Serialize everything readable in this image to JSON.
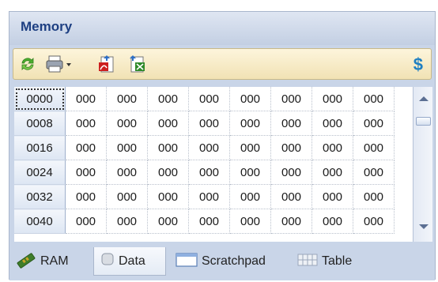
{
  "panel": {
    "title": "Memory"
  },
  "toolbar": {
    "refresh_icon": "refresh-icon",
    "print_icon": "printer-icon",
    "pdf_icon": "pdf-export-icon",
    "excel_icon": "excel-export-icon",
    "currency_symbol": "$"
  },
  "grid": {
    "rows": [
      {
        "address": "0000",
        "cells": [
          "000",
          "000",
          "000",
          "000",
          "000",
          "000",
          "000",
          "000"
        ]
      },
      {
        "address": "0008",
        "cells": [
          "000",
          "000",
          "000",
          "000",
          "000",
          "000",
          "000",
          "000"
        ]
      },
      {
        "address": "0016",
        "cells": [
          "000",
          "000",
          "000",
          "000",
          "000",
          "000",
          "000",
          "000"
        ]
      },
      {
        "address": "0024",
        "cells": [
          "000",
          "000",
          "000",
          "000",
          "000",
          "000",
          "000",
          "000"
        ]
      },
      {
        "address": "0032",
        "cells": [
          "000",
          "000",
          "000",
          "000",
          "000",
          "000",
          "000",
          "000"
        ]
      },
      {
        "address": "0040",
        "cells": [
          "000",
          "000",
          "000",
          "000",
          "000",
          "000",
          "000",
          "000"
        ]
      }
    ]
  },
  "tabs": [
    {
      "label": "RAM",
      "icon": "ram-chip-icon"
    },
    {
      "label": "Data",
      "icon": "database-icon"
    },
    {
      "label": "Scratchpad",
      "icon": "window-icon"
    },
    {
      "label": "Table",
      "icon": "table-grid-icon"
    }
  ],
  "colors": {
    "title": "#1d3f82",
    "currency": "#1f7fc2",
    "toolbar_bg": "#f1e2b4"
  }
}
